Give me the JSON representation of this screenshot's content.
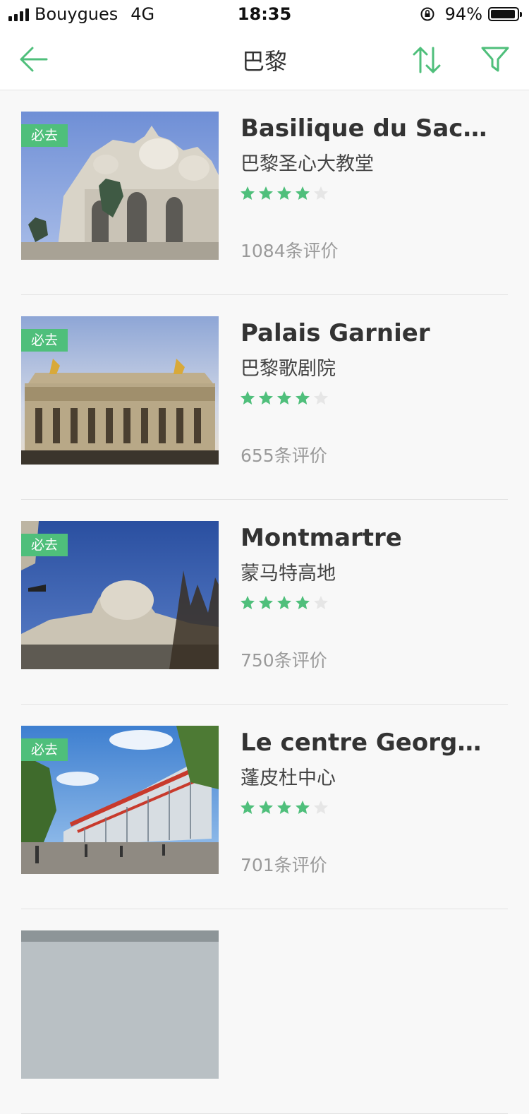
{
  "status_bar": {
    "carrier": "Bouygues",
    "network": "4G",
    "time": "18:35",
    "battery": "94%",
    "battery_level": 0.94
  },
  "nav": {
    "title": "巴黎",
    "back_icon": "back-arrow-icon",
    "sort_icon": "sort-icon",
    "filter_icon": "filter-icon",
    "accent_color": "#4fbf7b"
  },
  "pois": [
    {
      "name": "Basilique du Sacré…",
      "subname": "巴黎圣心大教堂",
      "badge": "必去",
      "rating": 4,
      "reviews": "1084条评价"
    },
    {
      "name": "Palais Garnier",
      "subname": "巴黎歌剧院",
      "badge": "必去",
      "rating": 4,
      "reviews": "655条评价"
    },
    {
      "name": "Montmartre",
      "subname": "蒙马特高地",
      "badge": "必去",
      "rating": 4,
      "reviews": "750条评价"
    },
    {
      "name": "Le centre Georges P…",
      "subname": "蓬皮杜中心",
      "badge": "必去",
      "rating": 4,
      "reviews": "701条评价"
    }
  ]
}
